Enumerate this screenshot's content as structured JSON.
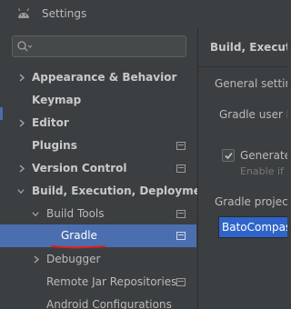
{
  "window": {
    "title": "Settings",
    "icon": "android-icon"
  },
  "search": {
    "placeholder": "",
    "icon": "search-icon"
  },
  "tree": [
    {
      "label": "Appearance & Behavior",
      "bold": true,
      "expandable": true,
      "expanded": false
    },
    {
      "label": "Keymap",
      "bold": true,
      "expandable": false
    },
    {
      "label": "Editor",
      "bold": true,
      "expandable": true,
      "expanded": false
    },
    {
      "label": "Plugins",
      "bold": true,
      "expandable": false,
      "project_icon": true
    },
    {
      "label": "Version Control",
      "bold": true,
      "expandable": true,
      "expanded": false,
      "project_icon": true
    },
    {
      "label": "Build, Execution, Deployment",
      "bold": true,
      "expandable": true,
      "expanded": true
    },
    {
      "label": "Build Tools",
      "bold": false,
      "expandable": true,
      "expanded": true,
      "project_icon": true
    },
    {
      "label": "Gradle",
      "bold": false,
      "selected": true,
      "project_icon": true,
      "annotation": "red-underline"
    },
    {
      "label": "Debugger",
      "bold": false,
      "expandable": true,
      "expanded": false
    },
    {
      "label": "Remote Jar Repositories",
      "bold": false,
      "project_icon": true
    },
    {
      "label": "Android Configurations",
      "bold": false
    }
  ],
  "content": {
    "title": "Build, Execution",
    "general_settings": "General settings",
    "gradle_user_home": "Gradle user hc",
    "generate_checkbox": {
      "label": "Generate",
      "checked": true,
      "hint": "Enable if y"
    },
    "gradle_projects": "Gradle projects",
    "project_item": "BatoCompass"
  },
  "colors": {
    "background": "#3c3f41",
    "selection": "#4b6eaf",
    "list_selection": "#2f65ca",
    "annotation": "#e0201e"
  }
}
